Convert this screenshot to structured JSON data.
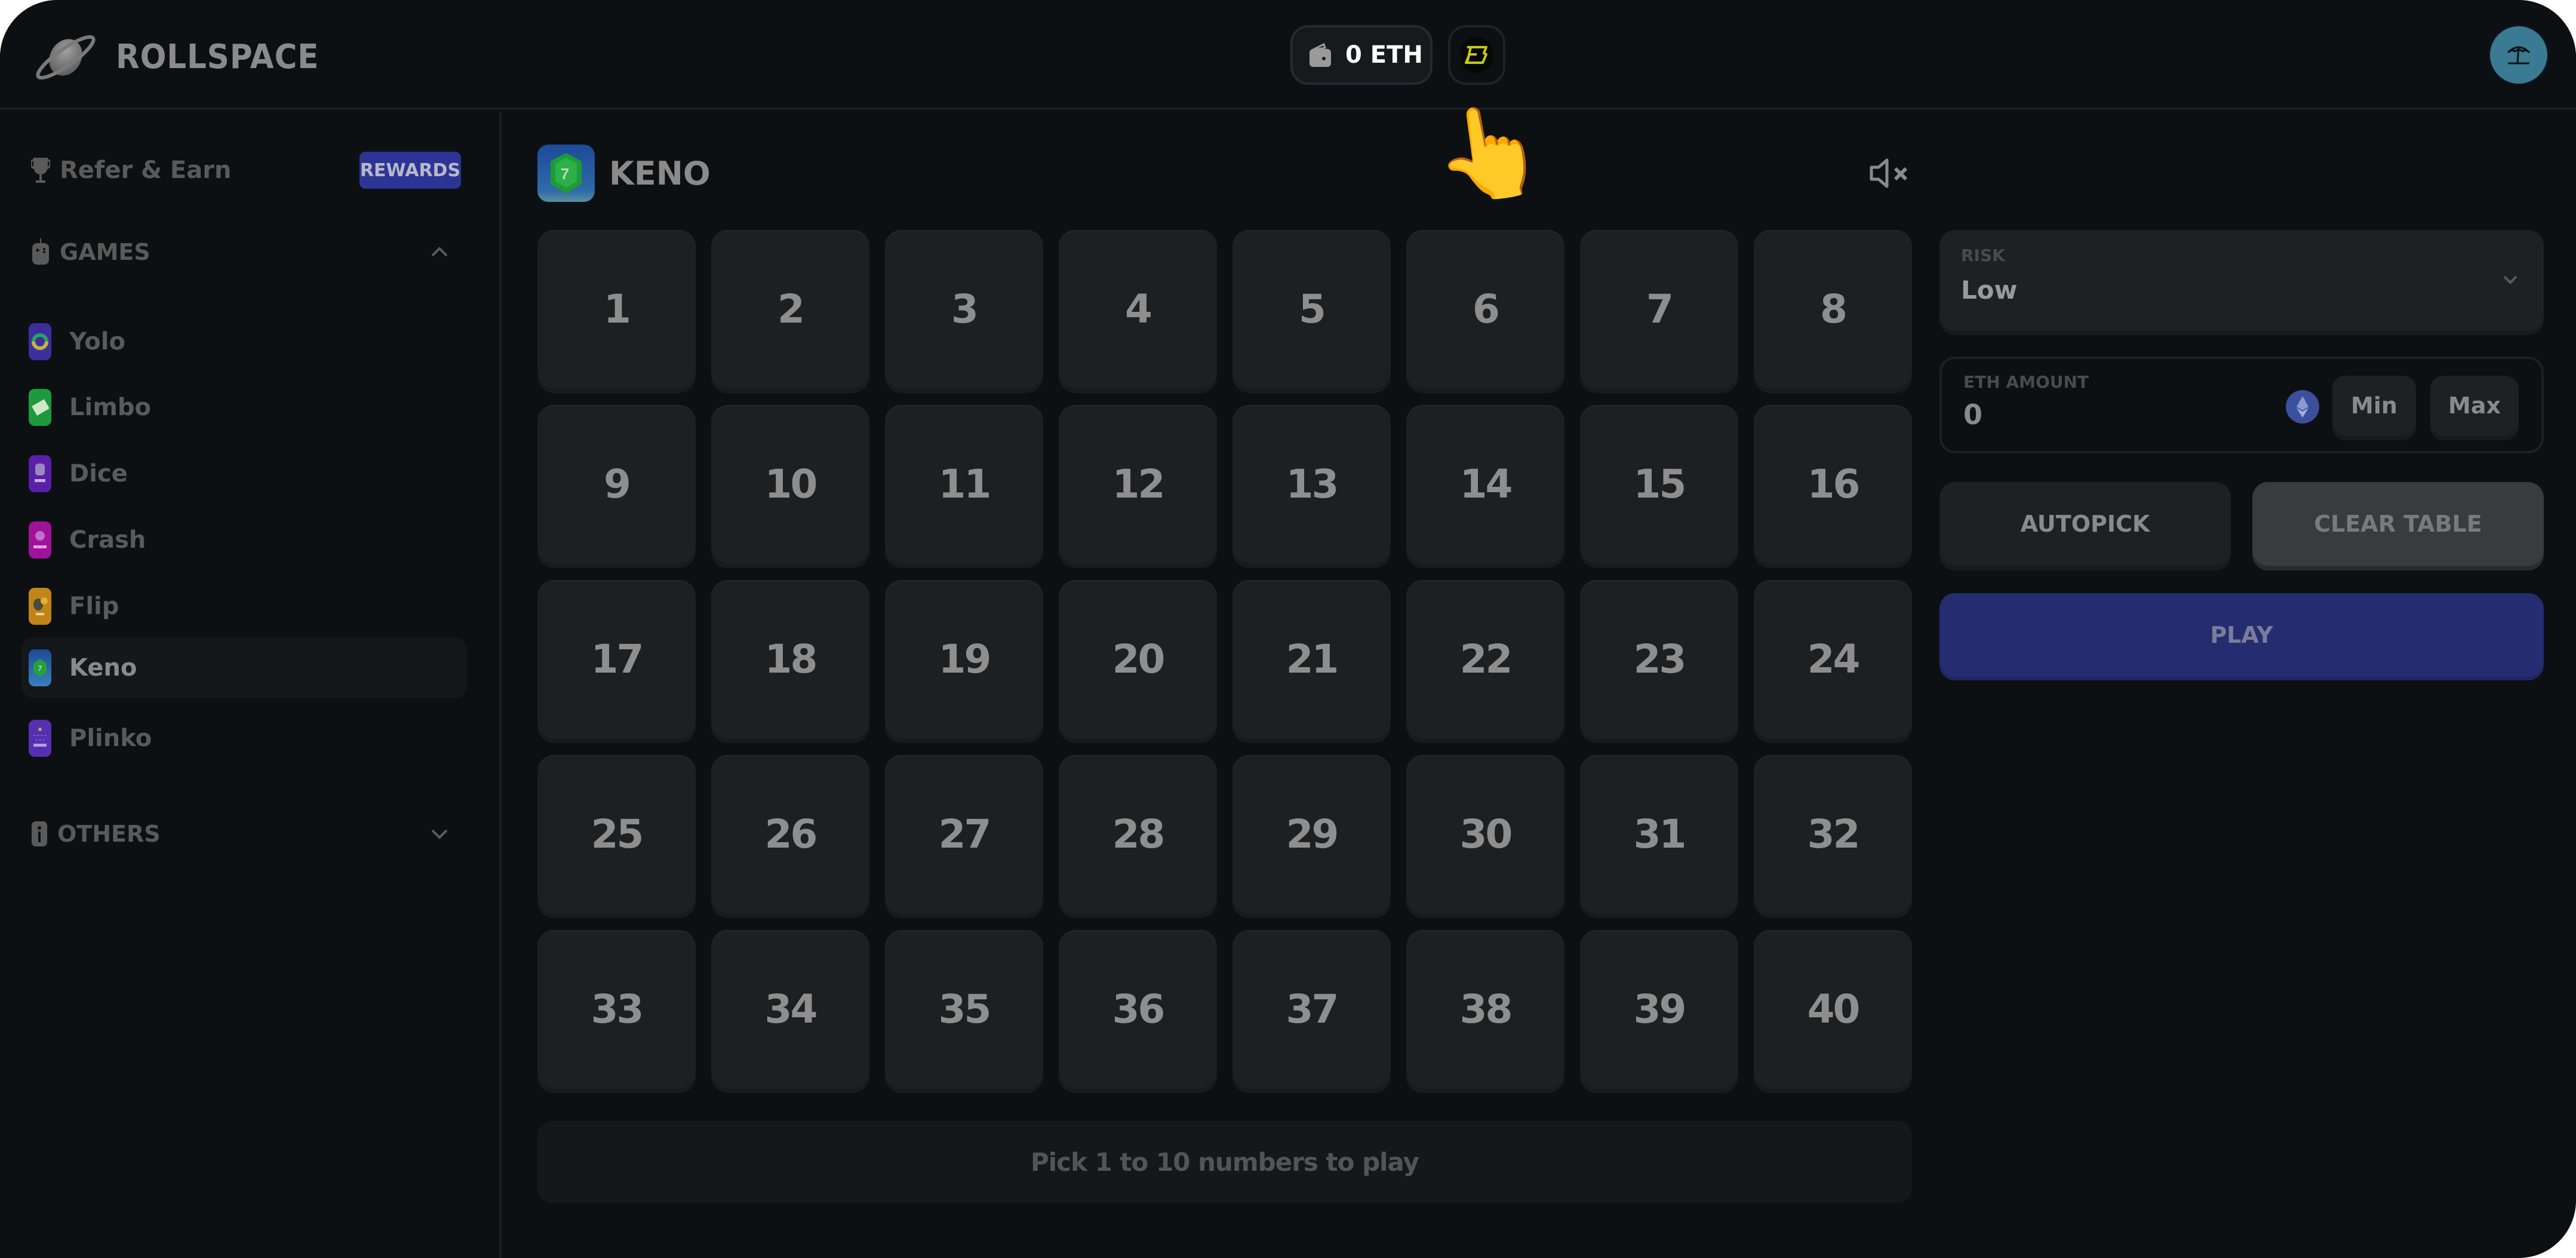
{
  "header": {
    "brand": "ROLLSPACE",
    "wallet_balance": "0 ETH",
    "icons": {
      "logo": "planet-logo-icon",
      "wallet": "wallet-icon",
      "blast": "blast-logo-icon",
      "avatar": "beach-umbrella-icon"
    }
  },
  "sidebar": {
    "refer_label": "Refer & Earn",
    "rewards_badge": "REWARDS",
    "games_section": "GAMES",
    "others_section": "OTHERS",
    "games": [
      {
        "label": "Yolo",
        "icon": "yolo-game-icon",
        "color": "#3b2fa0",
        "active": false
      },
      {
        "label": "Limbo",
        "icon": "limbo-game-icon",
        "color": "#1e9a3e",
        "active": false
      },
      {
        "label": "Dice",
        "icon": "dice-game-icon",
        "color": "#5a1fa8",
        "active": false
      },
      {
        "label": "Crash",
        "icon": "crash-game-icon",
        "color": "#a0129a",
        "active": false
      },
      {
        "label": "Flip",
        "icon": "flip-game-icon",
        "color": "#c08418",
        "active": false
      },
      {
        "label": "Keno",
        "icon": "keno-game-icon",
        "color": "#1d4a98",
        "active": true
      },
      {
        "label": "Plinko",
        "icon": "plinko-game-icon",
        "color": "#5430b0",
        "active": false
      }
    ]
  },
  "main": {
    "title": "KENO",
    "sound": "muted",
    "numbers": [
      "1",
      "2",
      "3",
      "4",
      "5",
      "6",
      "7",
      "8",
      "9",
      "10",
      "11",
      "12",
      "13",
      "14",
      "15",
      "16",
      "17",
      "18",
      "19",
      "20",
      "21",
      "22",
      "23",
      "24",
      "25",
      "26",
      "27",
      "28",
      "29",
      "30",
      "31",
      "32",
      "33",
      "34",
      "35",
      "36",
      "37",
      "38",
      "39",
      "40"
    ],
    "status_text": "Pick 1 to 10 numbers to play"
  },
  "panel": {
    "risk_label": "RISK",
    "risk_value": "Low",
    "amount_label": "ETH AMOUNT",
    "amount_value": "0",
    "min_label": "Min",
    "max_label": "Max",
    "autopick_label": "AUTOPICK",
    "clear_label": "CLEAR TABLE",
    "play_label": "PLAY"
  },
  "colors": {
    "background": "#0d1012",
    "tile": "#1d2022",
    "accent": "#2c3596",
    "play_button": "#262c70",
    "avatar": "#3a7a92"
  },
  "cursor": "pointing-hand"
}
